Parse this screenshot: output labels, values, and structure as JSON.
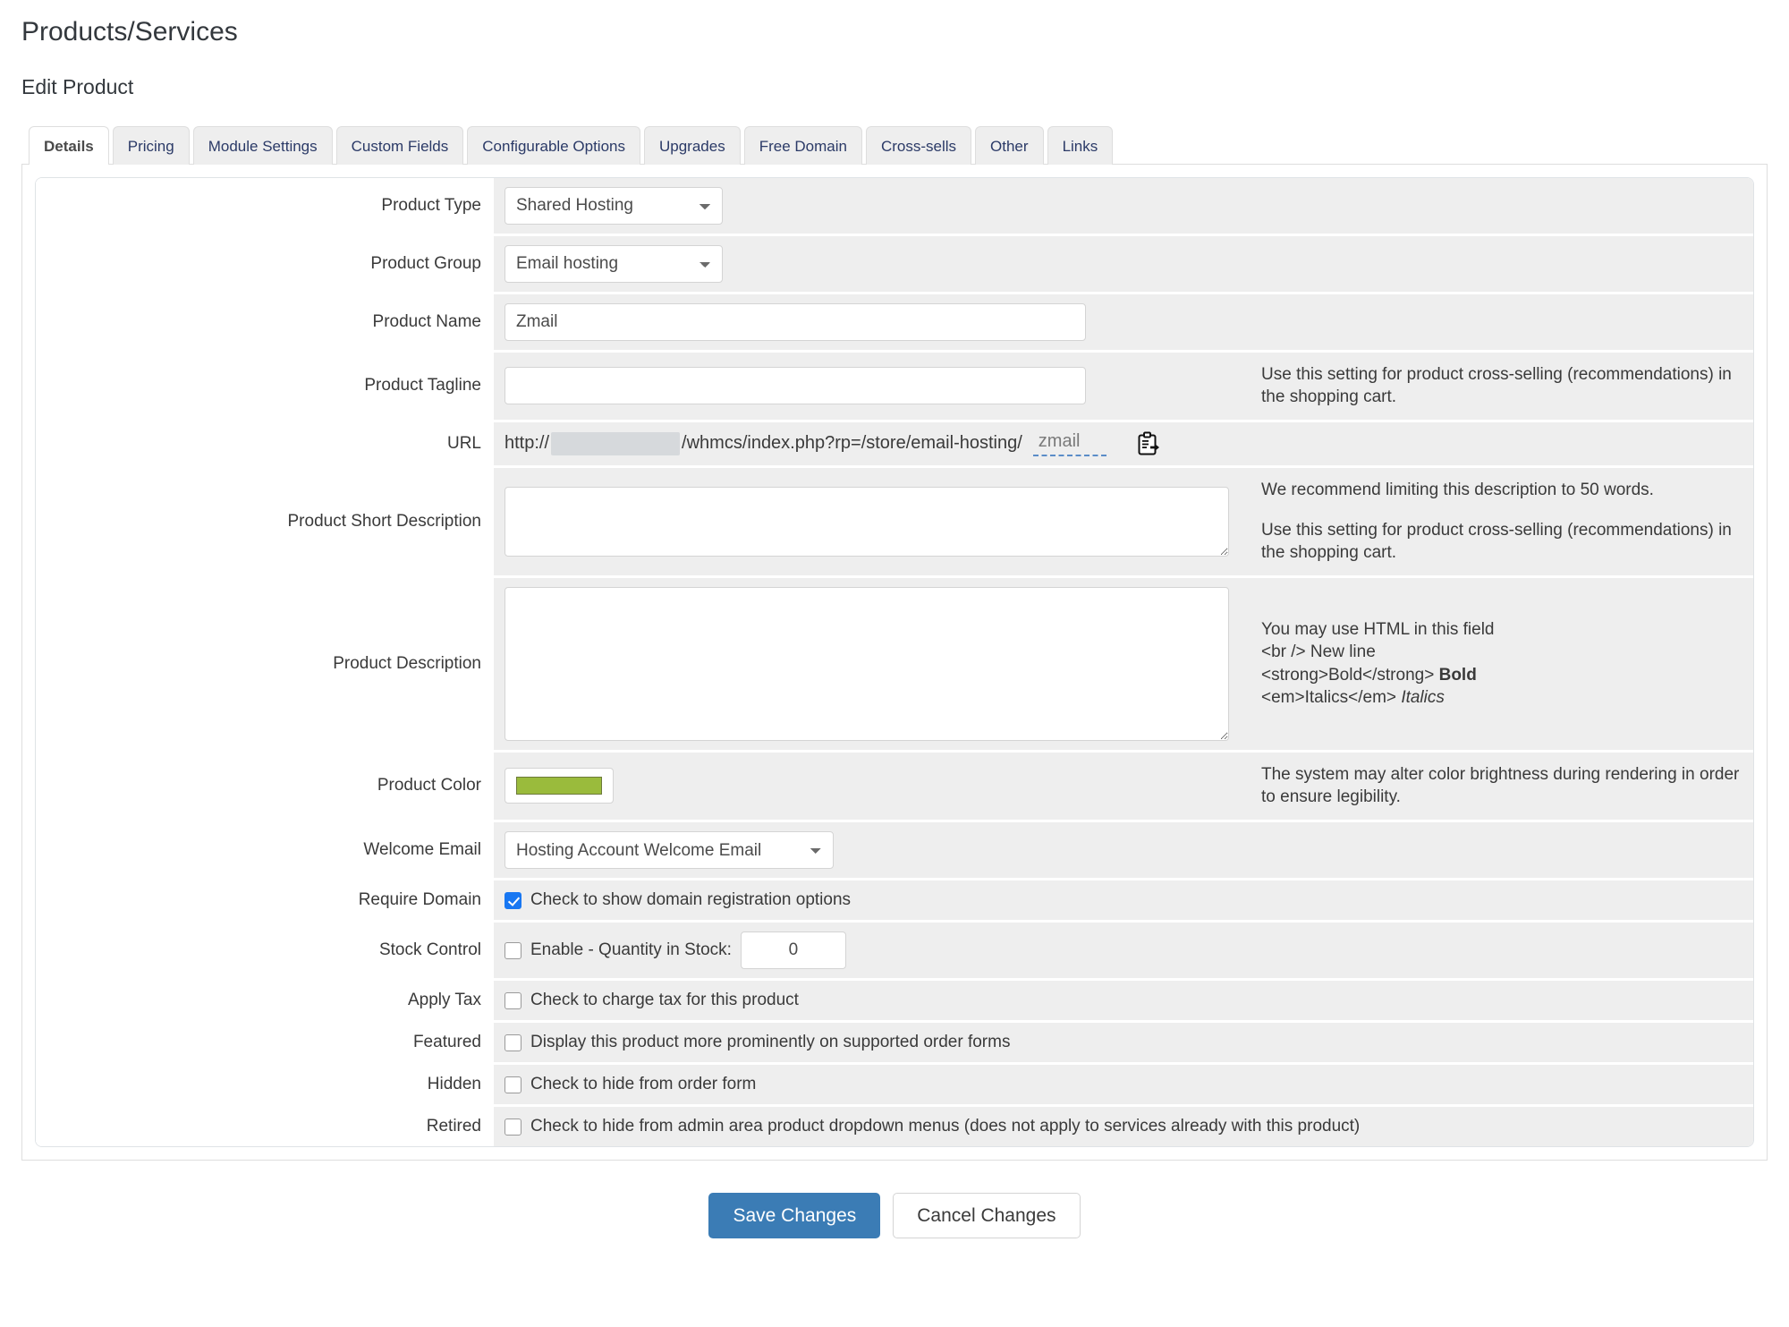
{
  "header": {
    "page_title": "Products/Services",
    "sub_title": "Edit Product"
  },
  "tabs": [
    {
      "label": "Details",
      "active": true
    },
    {
      "label": "Pricing",
      "active": false
    },
    {
      "label": "Module Settings",
      "active": false
    },
    {
      "label": "Custom Fields",
      "active": false
    },
    {
      "label": "Configurable Options",
      "active": false
    },
    {
      "label": "Upgrades",
      "active": false
    },
    {
      "label": "Free Domain",
      "active": false
    },
    {
      "label": "Cross-sells",
      "active": false
    },
    {
      "label": "Other",
      "active": false
    },
    {
      "label": "Links",
      "active": false
    }
  ],
  "form": {
    "product_type": {
      "label": "Product Type",
      "value": "Shared Hosting",
      "options": [
        "Shared Hosting"
      ]
    },
    "product_group": {
      "label": "Product Group",
      "value": "Email hosting",
      "options": [
        "Email hosting"
      ]
    },
    "product_name": {
      "label": "Product Name",
      "value": "Zmail",
      "placeholder": ""
    },
    "product_tagline": {
      "label": "Product Tagline",
      "value": "",
      "placeholder": "",
      "help": "Use this setting for product cross-selling (recommendations) in the shopping cart."
    },
    "url": {
      "label": "URL",
      "prefix": "http://",
      "path": "/whmcs/index.php?rp=/store/email-hosting/",
      "slug": "zmail",
      "icon": "paste-clipboard-icon"
    },
    "short_description": {
      "label": "Product Short Description",
      "value": "",
      "help_1": "We recommend limiting this description to 50 words.",
      "help_2": "Use this setting for product cross-selling (recommendations) in the shopping cart."
    },
    "description": {
      "label": "Product Description",
      "value": "",
      "help_line_1": "You may use HTML in this field",
      "help_line_2": "<br /> New line",
      "help_line_3_code": "<strong>Bold</strong>",
      "help_line_3_sample": "Bold",
      "help_line_4_code": "<em>Italics</em>",
      "help_line_4_sample": "Italics"
    },
    "product_color": {
      "label": "Product Color",
      "value": "#9ABB3C",
      "help": "The system may alter color brightness during rendering in order to ensure legibility."
    },
    "welcome_email": {
      "label": "Welcome Email",
      "value": "Hosting Account Welcome Email",
      "options": [
        "Hosting Account Welcome Email"
      ]
    },
    "require_domain": {
      "label": "Require Domain",
      "checkbox_label": "Check to show domain registration options",
      "checked": true
    },
    "stock_control": {
      "label": "Stock Control",
      "checkbox_label": "Enable - Quantity in Stock:",
      "checked": false,
      "quantity": "0"
    },
    "apply_tax": {
      "label": "Apply Tax",
      "checkbox_label": "Check to charge tax for this product",
      "checked": false
    },
    "featured": {
      "label": "Featured",
      "checkbox_label": "Display this product more prominently on supported order forms",
      "checked": false
    },
    "hidden": {
      "label": "Hidden",
      "checkbox_label": "Check to hide from order form",
      "checked": false
    },
    "retired": {
      "label": "Retired",
      "checkbox_label": "Check to hide from admin area product dropdown menus (does not apply to services already with this product)",
      "checked": false
    }
  },
  "actions": {
    "save_label": "Save Changes",
    "cancel_label": "Cancel Changes"
  },
  "colors": {
    "primary_button": "#3b7cb5",
    "checkbox_checked": "#1877f2",
    "tab_link": "#2b3a67",
    "product_color_swatch": "#9ABB3C"
  }
}
